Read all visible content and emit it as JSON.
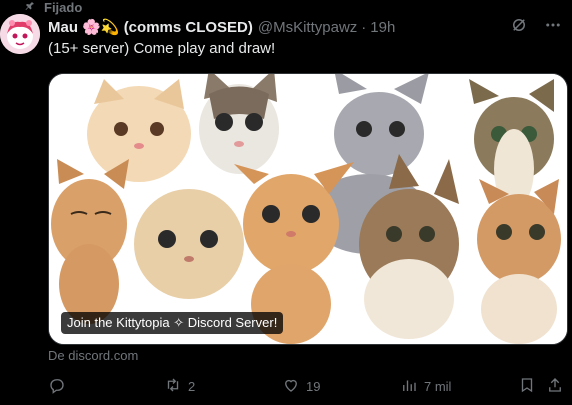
{
  "pinned_label": "Fijado",
  "author": {
    "name": "Mau 🌸💫 (comms CLOSED)",
    "handle": "@MsKittypawz",
    "time": "19h"
  },
  "tweet_text": "(15+ server) Come play and draw!",
  "card": {
    "title": "Join the Kittytopia ✧ Discord Server!",
    "source": "De discord.com"
  },
  "actions": {
    "reply_count": "",
    "retweet_count": "2",
    "like_count": "19",
    "views_count": "7 mil"
  },
  "icons": {
    "pin": "pin-icon",
    "grok": "grok-icon",
    "more": "more-icon",
    "reply": "reply-icon",
    "retweet": "retweet-icon",
    "like": "heart-icon",
    "views": "views-icon",
    "bookmark": "bookmark-icon",
    "share": "share-icon"
  },
  "colors": {
    "background": "#000000",
    "text": "#e7e9ea",
    "secondary": "#71767b",
    "border": "#2f3336"
  }
}
